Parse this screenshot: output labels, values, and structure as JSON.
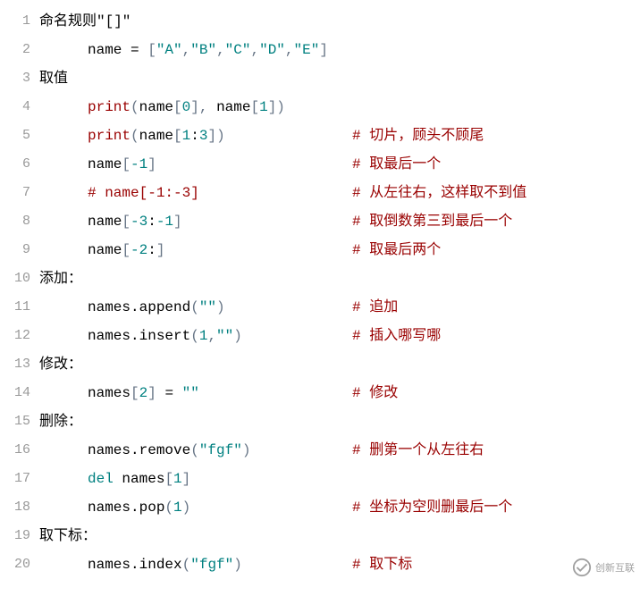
{
  "lines": {
    "l1": "命名规则\"[]\"",
    "l2_name": "name",
    "l2_eq": " = ",
    "l2_b1": "[",
    "l2_s1": "\"A\"",
    "l2_c": ",",
    "l2_s2": "\"B\"",
    "l2_s3": "\"C\"",
    "l2_s4": "\"D\"",
    "l2_s5": "\"E\"",
    "l2_b2": "]",
    "l3": "取值",
    "l4_print": "print",
    "l4_lp": "(",
    "l4_var": "name",
    "l4_lb": "[",
    "l4_n0": "0",
    "l4_rb": "]",
    "l4_cm": ", ",
    "l4_var2": "name",
    "l4_lb2": "[",
    "l4_n1": "1",
    "l4_rb2": "]",
    "l4_rp": ")",
    "l5_print": "print",
    "l5_lp": "(",
    "l5_var": "name",
    "l5_lb": "[",
    "l5_n1": "1",
    "l5_colon": ":",
    "l5_n3": "3",
    "l5_rb": "]",
    "l5_rp": ")",
    "l5_cmt": "# 切片，顾头不顾尾",
    "l6_var": "name",
    "l6_lb": "[",
    "l6_n": "-1",
    "l6_rb": "]",
    "l6_cmt": "# 取最后一个",
    "l7_code": "# name[-1:-3]",
    "l7_cmt": "# 从左往右，这样取不到值",
    "l8_var": "name",
    "l8_lb": "[",
    "l8_n1": "-3",
    "l8_colon": ":",
    "l8_n2": "-1",
    "l8_rb": "]",
    "l8_cmt": "# 取倒数第三到最后一个",
    "l9_var": "name",
    "l9_lb": "[",
    "l9_n": "-2",
    "l9_colon": ":",
    "l9_rb": "]",
    "l9_cmt": "# 取最后两个",
    "l10": "添加：",
    "l11_var": "names.append",
    "l11_lp": "(",
    "l11_s": "\"\"",
    "l11_rp": ")",
    "l11_cmt": "# 追加",
    "l12_var": "names.insert",
    "l12_lp": "(",
    "l12_n": "1",
    "l12_cm": ",",
    "l12_s": "\"\"",
    "l12_rp": ")",
    "l12_cmt": "# 插入哪写哪",
    "l13": "修改：",
    "l14_var": "names",
    "l14_lb": "[",
    "l14_n": "2",
    "l14_rb": "]",
    "l14_eq": " = ",
    "l14_s": "\"\"",
    "l14_cmt": "# 修改",
    "l15": "删除：",
    "l16_var": "names.remove",
    "l16_lp": "(",
    "l16_s": "\"fgf\"",
    "l16_rp": ")",
    "l16_cmt": "# 删第一个从左往右",
    "l17_del": "del",
    "l17_sp": " ",
    "l17_var": "names",
    "l17_lb": "[",
    "l17_n": "1",
    "l17_rb": "]",
    "l18_var": "names.pop",
    "l18_lp": "(",
    "l18_n": "1",
    "l18_rp": ")",
    "l18_cmt": "# 坐标为空则删最后一个",
    "l19": "取下标：",
    "l20_var": "names.index",
    "l20_lp": "(",
    "l20_s": "\"fgf\"",
    "l20_rp": ")",
    "l20_cmt": "# 取下标"
  },
  "line_numbers": [
    "1",
    "2",
    "3",
    "4",
    "5",
    "6",
    "7",
    "8",
    "9",
    "10",
    "11",
    "12",
    "13",
    "14",
    "15",
    "16",
    "17",
    "18",
    "19",
    "20"
  ],
  "watermark": "创新互联"
}
